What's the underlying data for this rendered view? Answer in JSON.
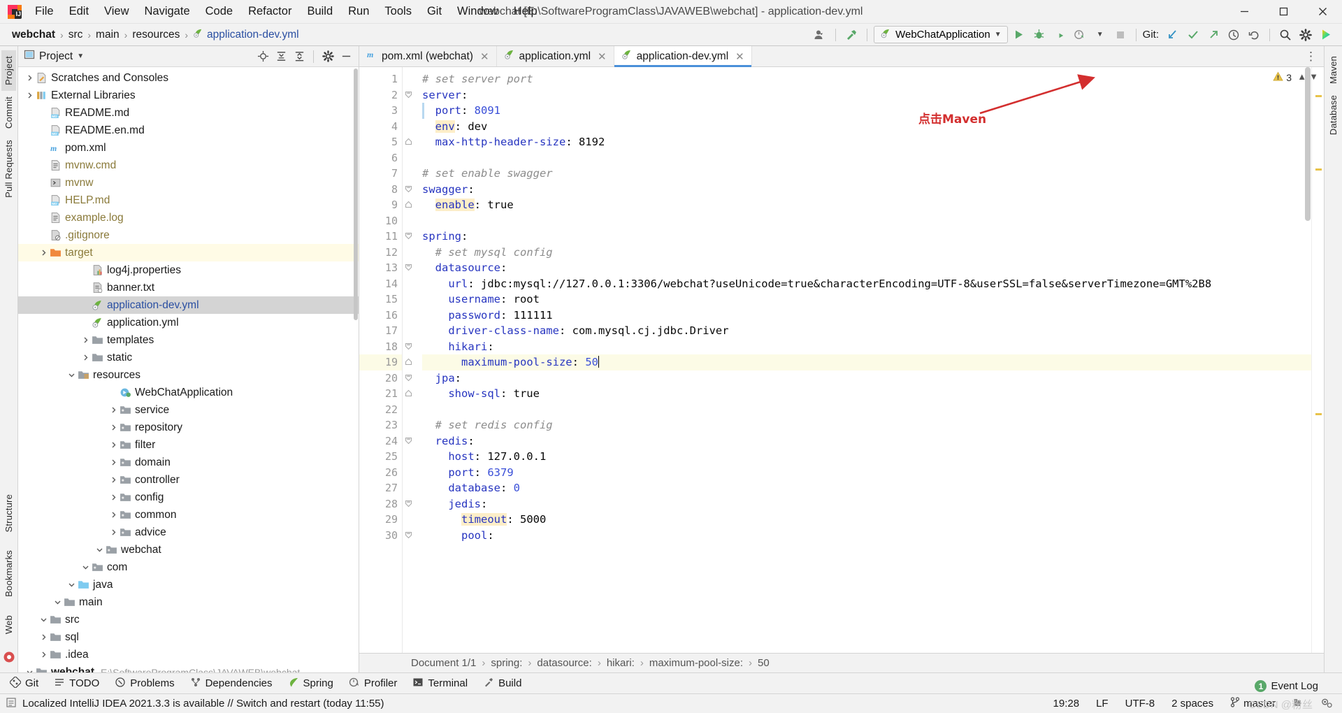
{
  "window": {
    "title": "webchat [E:\\SoftwareProgramClass\\JAVAWEB\\webchat] - application-dev.yml",
    "minimize_label": "–",
    "maximize_label": "❐",
    "close_label": "✕"
  },
  "menu": [
    {
      "label": "File"
    },
    {
      "label": "Edit"
    },
    {
      "label": "View"
    },
    {
      "label": "Navigate"
    },
    {
      "label": "Code"
    },
    {
      "label": "Refactor"
    },
    {
      "label": "Build"
    },
    {
      "label": "Run"
    },
    {
      "label": "Tools"
    },
    {
      "label": "Git"
    },
    {
      "label": "Window"
    },
    {
      "label": "Help"
    }
  ],
  "navbar": {
    "crumbs": [
      "webchat",
      "src",
      "main",
      "resources",
      "application-dev.yml"
    ],
    "separator": "›",
    "run_config": "WebChatApplication",
    "git_label": "Git:",
    "icons": [
      "user-avatar-icon",
      "hammer-build-icon",
      "run-icon",
      "debug-icon",
      "run-with-coverage-icon",
      "profiler-dropdown-icon",
      "stop-icon",
      "git-update-icon",
      "git-commit-icon",
      "git-push-icon",
      "git-history-icon",
      "git-rollback-icon",
      "search-everywhere-icon",
      "settings-gear-icon",
      "ide-assistant-icon"
    ]
  },
  "left_strip": {
    "tabs": [
      {
        "label": "Project",
        "active": true
      },
      {
        "label": "Commit",
        "active": false
      },
      {
        "label": "Pull Requests",
        "active": false
      }
    ],
    "bottom_tabs": [
      {
        "label": "Structure"
      },
      {
        "label": "Bookmarks"
      },
      {
        "label": "Web"
      }
    ]
  },
  "right_strip": {
    "tabs": [
      {
        "label": "Maven"
      },
      {
        "label": "Database"
      }
    ]
  },
  "project_panel": {
    "title": "Project",
    "actions": [
      "locate-target-icon",
      "expand-all-icon",
      "collapse-all-icon",
      "gear-icon",
      "hide-icon"
    ],
    "tree": [
      {
        "depth": 0,
        "arrow": "down",
        "icon": "module-folder",
        "label": "webchat",
        "path": "E:\\SoftwareProgramClass\\JAVAWEB\\webchat",
        "bold": true
      },
      {
        "depth": 1,
        "arrow": "right",
        "icon": "folder",
        "label": ".idea"
      },
      {
        "depth": 1,
        "arrow": "right",
        "icon": "folder",
        "label": "sql"
      },
      {
        "depth": 1,
        "arrow": "down",
        "icon": "folder",
        "label": "src"
      },
      {
        "depth": 2,
        "arrow": "down",
        "icon": "folder",
        "label": "main"
      },
      {
        "depth": 3,
        "arrow": "down",
        "icon": "source-folder",
        "label": "java"
      },
      {
        "depth": 4,
        "arrow": "down",
        "icon": "package",
        "label": "com"
      },
      {
        "depth": 5,
        "arrow": "down",
        "icon": "package",
        "label": "webchat"
      },
      {
        "depth": 6,
        "arrow": "right",
        "icon": "package",
        "label": "advice"
      },
      {
        "depth": 6,
        "arrow": "right",
        "icon": "package",
        "label": "common"
      },
      {
        "depth": 6,
        "arrow": "right",
        "icon": "package",
        "label": "config"
      },
      {
        "depth": 6,
        "arrow": "right",
        "icon": "package",
        "label": "controller"
      },
      {
        "depth": 6,
        "arrow": "right",
        "icon": "package",
        "label": "domain"
      },
      {
        "depth": 6,
        "arrow": "right",
        "icon": "package",
        "label": "filter"
      },
      {
        "depth": 6,
        "arrow": "right",
        "icon": "package",
        "label": "repository"
      },
      {
        "depth": 6,
        "arrow": "right",
        "icon": "package",
        "label": "service"
      },
      {
        "depth": 6,
        "arrow": "none",
        "icon": "spring-class",
        "label": "WebChatApplication"
      },
      {
        "depth": 3,
        "arrow": "down",
        "icon": "resources-folder",
        "label": "resources"
      },
      {
        "depth": 4,
        "arrow": "right",
        "icon": "folder",
        "label": "static"
      },
      {
        "depth": 4,
        "arrow": "right",
        "icon": "folder",
        "label": "templates"
      },
      {
        "depth": 4,
        "arrow": "none",
        "icon": "spring-yml",
        "label": "application.yml"
      },
      {
        "depth": 4,
        "arrow": "none",
        "icon": "spring-yml",
        "label": "application-dev.yml",
        "selected": true
      },
      {
        "depth": 4,
        "arrow": "none",
        "icon": "txt-file",
        "label": "banner.txt"
      },
      {
        "depth": 4,
        "arrow": "none",
        "icon": "properties-file",
        "label": "log4j.properties"
      },
      {
        "depth": 1,
        "arrow": "right",
        "icon": "excluded-folder",
        "label": "target",
        "excluded": true
      },
      {
        "depth": 1,
        "arrow": "none",
        "icon": "gitignore-file",
        "label": ".gitignore",
        "ignored": true
      },
      {
        "depth": 1,
        "arrow": "none",
        "icon": "log-file",
        "label": "example.log",
        "ignored": true
      },
      {
        "depth": 1,
        "arrow": "none",
        "icon": "md-file",
        "label": "HELP.md",
        "ignored": true
      },
      {
        "depth": 1,
        "arrow": "none",
        "icon": "shell-file",
        "label": "mvnw",
        "ignored": true
      },
      {
        "depth": 1,
        "arrow": "none",
        "icon": "cmd-file",
        "label": "mvnw.cmd",
        "ignored": true
      },
      {
        "depth": 1,
        "arrow": "none",
        "icon": "maven-pom",
        "label": "pom.xml"
      },
      {
        "depth": 1,
        "arrow": "none",
        "icon": "md-file",
        "label": "README.en.md"
      },
      {
        "depth": 1,
        "arrow": "none",
        "icon": "md-file",
        "label": "README.md"
      },
      {
        "depth": 0,
        "arrow": "right",
        "icon": "libraries",
        "label": "External Libraries"
      },
      {
        "depth": 0,
        "arrow": "right",
        "icon": "scratches",
        "label": "Scratches and Consoles"
      }
    ]
  },
  "editor": {
    "tabs": [
      {
        "label": "pom.xml (webchat)",
        "icon": "maven-pom-icon",
        "active": false,
        "closable": true
      },
      {
        "label": "application.yml",
        "icon": "spring-yml-icon",
        "active": false,
        "closable": true
      },
      {
        "label": "application-dev.yml",
        "icon": "spring-yml-icon",
        "active": true,
        "closable": true
      }
    ],
    "warning_count": "3",
    "lines": [
      {
        "n": 1,
        "fold": "",
        "html": "<span class='cmt'># set server port</span>"
      },
      {
        "n": 2,
        "fold": "open",
        "html": "<span class='key'>server</span><span class='val'>:</span>"
      },
      {
        "n": 3,
        "fold": "",
        "html": "  <span class='key'>port</span><span class='val'>: </span><span class='num'>8091</span>",
        "marker": true
      },
      {
        "n": 4,
        "fold": "",
        "html": "  <span class='key hlk'>env</span><span class='val'>: dev</span>"
      },
      {
        "n": 5,
        "fold": "end",
        "html": "  <span class='key'>max-http-header-size</span><span class='val'>: 8192</span>"
      },
      {
        "n": 6,
        "fold": "",
        "html": ""
      },
      {
        "n": 7,
        "fold": "",
        "html": "<span class='cmt'># set enable swagger</span>"
      },
      {
        "n": 8,
        "fold": "open",
        "html": "<span class='key'>swagger</span><span class='val'>:</span>"
      },
      {
        "n": 9,
        "fold": "end",
        "html": "  <span class='key hlk'>enable</span><span class='val'>: true</span>"
      },
      {
        "n": 10,
        "fold": "",
        "html": ""
      },
      {
        "n": 11,
        "fold": "open",
        "html": "<span class='key'>spring</span><span class='val'>:</span>"
      },
      {
        "n": 12,
        "fold": "",
        "html": "  <span class='cmt'># set mysql config</span>"
      },
      {
        "n": 13,
        "fold": "open",
        "html": "  <span class='key'>datasource</span><span class='val'>:</span>"
      },
      {
        "n": 14,
        "fold": "",
        "html": "    <span class='key'>url</span><span class='val'>: jdbc:mysql://127.0.0.1:3306/webchat?useUnicode=true&amp;characterEncoding=UTF-8&amp;userSSL=false&amp;serverTimezone=GMT%2B8</span>"
      },
      {
        "n": 15,
        "fold": "",
        "html": "    <span class='key'>username</span><span class='val'>: root</span>"
      },
      {
        "n": 16,
        "fold": "",
        "html": "    <span class='key'>password</span><span class='val'>: 111111</span>"
      },
      {
        "n": 17,
        "fold": "",
        "html": "    <span class='key'>driver-class-name</span><span class='val'>: com.mysql.cj.jdbc.Driver</span>"
      },
      {
        "n": 18,
        "fold": "open",
        "html": "    <span class='key'>hikari</span><span class='val'>:</span>"
      },
      {
        "n": 19,
        "fold": "end",
        "html": "      <span class='key'>maximum-pool-size</span><span class='val'>: </span><span class='num'>50</span><span class='caret'></span>",
        "current": true
      },
      {
        "n": 20,
        "fold": "open",
        "html": "  <span class='key'>jpa</span><span class='val'>:</span>"
      },
      {
        "n": 21,
        "fold": "end",
        "html": "    <span class='key'>show-sql</span><span class='val'>: true</span>"
      },
      {
        "n": 22,
        "fold": "",
        "html": ""
      },
      {
        "n": 23,
        "fold": "",
        "html": "  <span class='cmt'># set redis config</span>"
      },
      {
        "n": 24,
        "fold": "open",
        "html": "  <span class='key'>redis</span><span class='val'>:</span>"
      },
      {
        "n": 25,
        "fold": "",
        "html": "    <span class='key'>host</span><span class='val'>: 127.0.0.1</span>"
      },
      {
        "n": 26,
        "fold": "",
        "html": "    <span class='key'>port</span><span class='val'>: </span><span class='num'>6379</span>"
      },
      {
        "n": 27,
        "fold": "",
        "html": "    <span class='key'>database</span><span class='val'>: </span><span class='num'>0</span>"
      },
      {
        "n": 28,
        "fold": "open",
        "html": "    <span class='key'>jedis</span><span class='val'>:</span>"
      },
      {
        "n": 29,
        "fold": "",
        "html": "      <span class='key hlk'>timeout</span><span class='val'>: 5000</span>"
      },
      {
        "n": 30,
        "fold": "open",
        "html": "      <span class='key'>pool</span><span class='val'>:</span>"
      }
    ],
    "breadcrumb": [
      "Document 1/1",
      "spring:",
      "datasource:",
      "hikari:",
      "maximum-pool-size:",
      "50"
    ],
    "breadcrumb_separator": "›"
  },
  "bottom_toolwindows": [
    {
      "label": "Git",
      "icon": "git-icon"
    },
    {
      "label": "TODO",
      "icon": "todo-icon"
    },
    {
      "label": "Problems",
      "icon": "problems-icon"
    },
    {
      "label": "Dependencies",
      "icon": "dependencies-icon"
    },
    {
      "label": "Spring",
      "icon": "spring-icon"
    },
    {
      "label": "Profiler",
      "icon": "profiler-icon"
    },
    {
      "label": "Terminal",
      "icon": "terminal-icon"
    },
    {
      "label": "Build",
      "icon": "build-icon"
    }
  ],
  "event_log": {
    "label": "Event Log",
    "count": "1"
  },
  "statusbar": {
    "message": "Localized IntelliJ IDEA 2021.3.3 is available // Switch and restart (today 11:55)",
    "position": "19:28",
    "line_separator": "LF",
    "encoding": "UTF-8",
    "indent": "2 spaces",
    "branch": "master",
    "icons": [
      "lock-icon",
      "branch-icon",
      "inspection-icon",
      "background-tasks-icon"
    ]
  },
  "annotation": {
    "text": "点击Maven",
    "color": "#d32f2f"
  },
  "watermark": "CSDN @粉丝",
  "colors": {
    "accent": "#4a90d9",
    "keyword": "#2735c0",
    "number": "#3a4fd8",
    "comment": "#8c8c8c",
    "selection": "#d4d4d4",
    "highlight": "#fdeec8",
    "current_line": "#fcfbe6",
    "green": "#59a869",
    "warning": "#c9a227",
    "link": "#2a4fa2"
  }
}
